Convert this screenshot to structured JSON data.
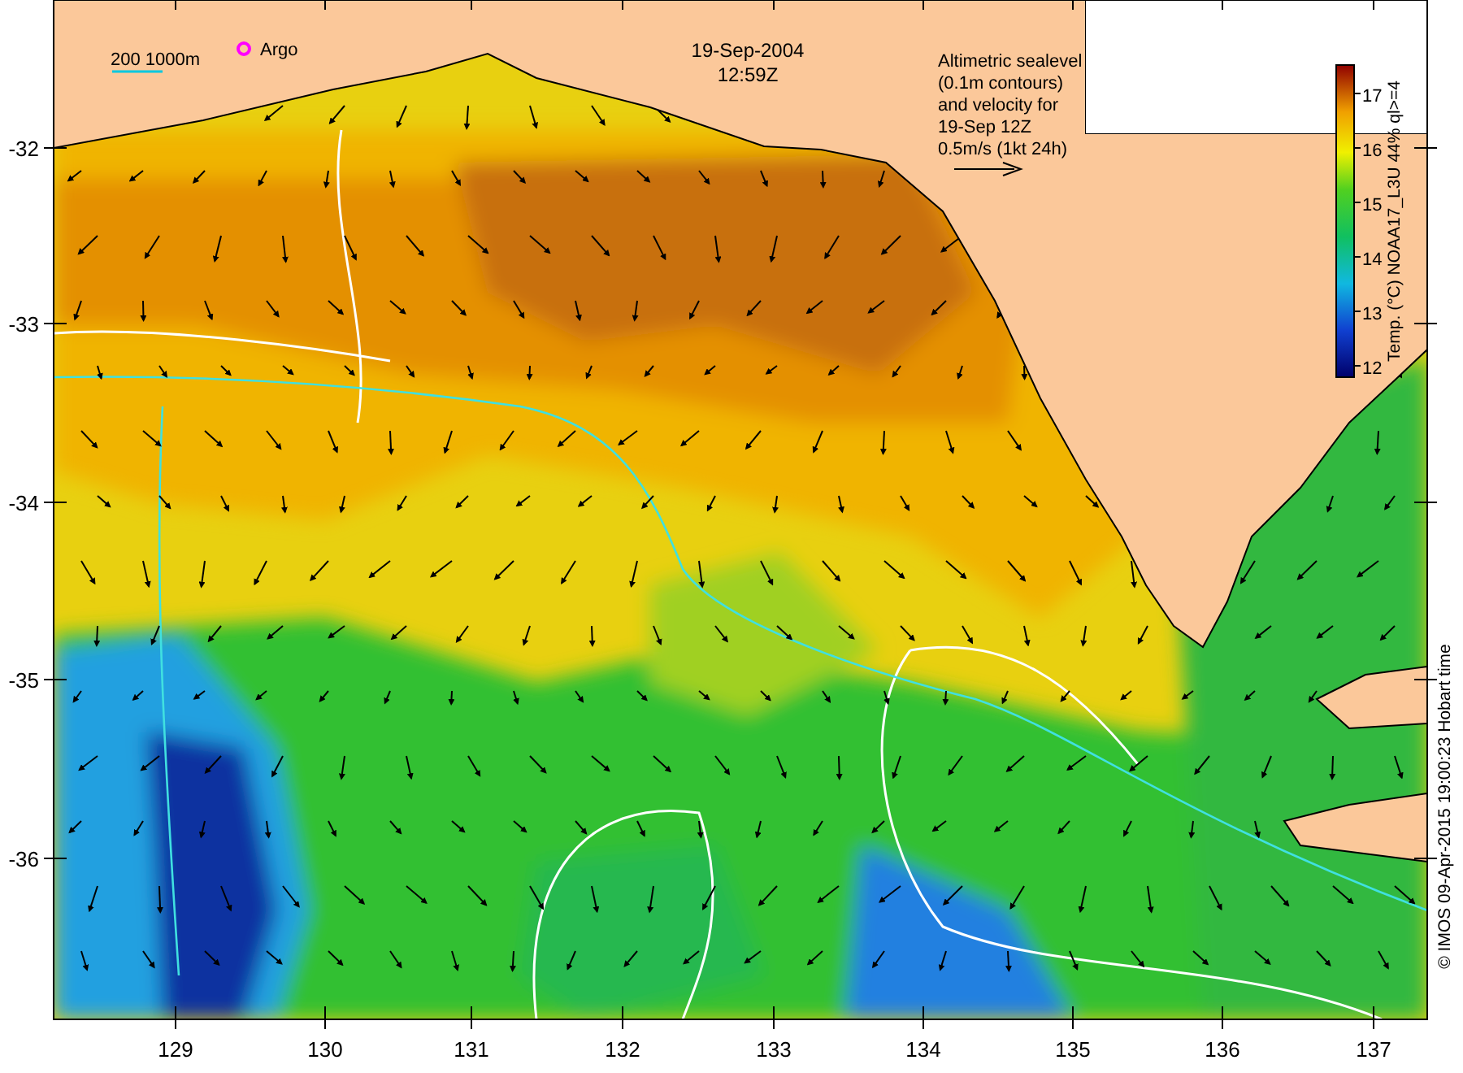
{
  "map": {
    "date": "19-Sep-2004",
    "time": "12:59Z",
    "scale_bar": "200  1000m",
    "argo_label": "Argo",
    "velocity_legend": [
      "Altimetric sealevel",
      "(0.1m contours)",
      "and velocity for",
      "19-Sep 12Z",
      "0.5m/s (1kt 24h)"
    ],
    "colorbar": {
      "label": "Temp. (°C) NOAA17_L3U 44% ql>=4",
      "ticks": [
        "17",
        "16",
        "15",
        "14",
        "13",
        "12"
      ]
    },
    "credit": "© IMOS 09-Apr-2015 19:00:23 Hobart time",
    "y_ticks": [
      "-32",
      "-33",
      "-34",
      "-35",
      "-36"
    ],
    "x_ticks": [
      "129",
      "130",
      "131",
      "132",
      "133",
      "134",
      "135",
      "136",
      "137"
    ]
  }
}
